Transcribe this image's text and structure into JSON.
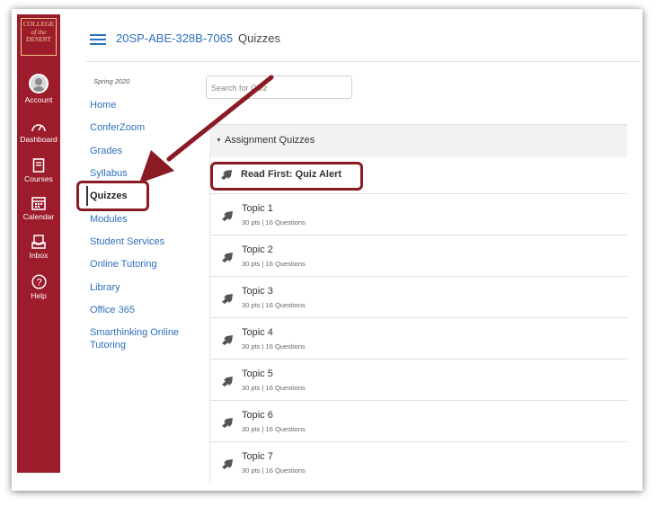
{
  "logo": {
    "line1": "COLLEGE",
    "line2": "of the",
    "line3": "DESERT"
  },
  "global_nav": [
    {
      "label": "Account",
      "icon": "user-avatar-icon"
    },
    {
      "label": "Dashboard",
      "icon": "dashboard-gauge-icon"
    },
    {
      "label": "Courses",
      "icon": "courses-book-icon"
    },
    {
      "label": "Calendar",
      "icon": "calendar-icon"
    },
    {
      "label": "Inbox",
      "icon": "inbox-icon"
    },
    {
      "label": "Help",
      "icon": "help-circle-icon"
    }
  ],
  "breadcrumb": {
    "course": "20SP-ABE-328B-7065",
    "separator": "›",
    "current": "Quizzes"
  },
  "course_nav": {
    "term": "Spring 2020",
    "items": [
      "Home",
      "ConferZoom",
      "Grades",
      "Syllabus",
      "Quizzes",
      "Modules",
      "Student Services",
      "Online Tutoring",
      "Library",
      "Office 365",
      "Smarthinking Online",
      "Tutoring"
    ],
    "active": "Quizzes"
  },
  "search": {
    "placeholder": "Search for Quiz"
  },
  "quiz_group": {
    "label": "Assignment Quizzes",
    "items": [
      {
        "title": "Read First: Quiz Alert",
        "meta": ""
      },
      {
        "title": "Topic 1",
        "meta": "30 pts  |  16 Questions"
      },
      {
        "title": "Topic 2",
        "meta": "30 pts  |  16 Questions"
      },
      {
        "title": "Topic 3",
        "meta": "30 pts  |  16 Questions"
      },
      {
        "title": "Topic 4",
        "meta": "30 pts  |  16 Questions"
      },
      {
        "title": "Topic 5",
        "meta": "30 pts  |  16 Questions"
      },
      {
        "title": "Topic 6",
        "meta": "30 pts  |  16 Questions"
      },
      {
        "title": "Topic 7",
        "meta": "30 pts  |  16 Questions"
      }
    ]
  },
  "colors": {
    "brand": "#9d1c2b",
    "link": "#2d6fbd",
    "highlight": "#8a1a24"
  }
}
